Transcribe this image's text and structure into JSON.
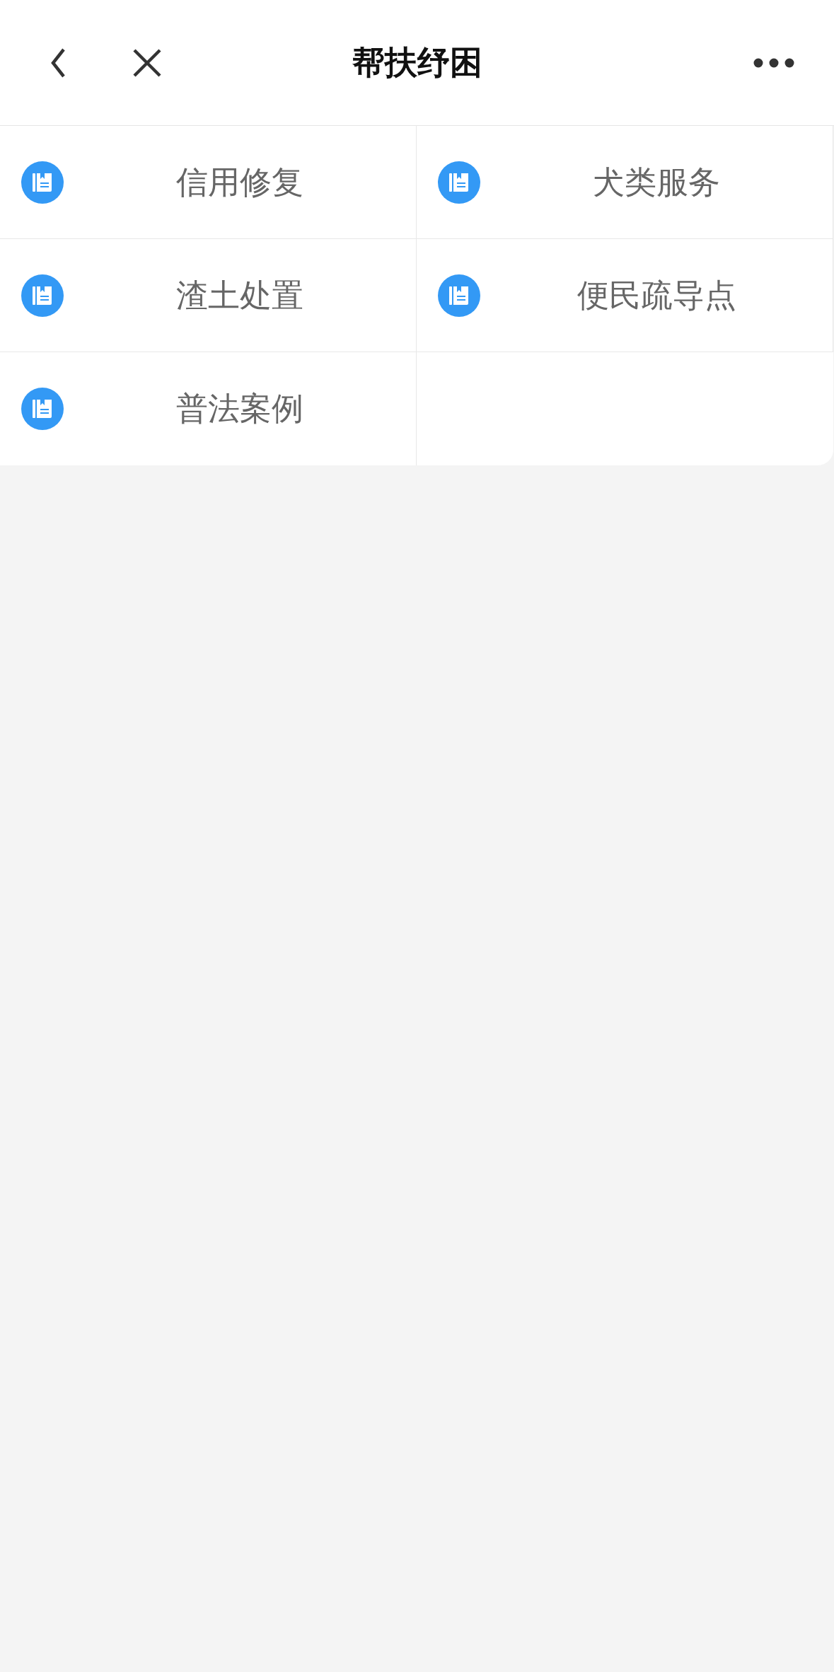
{
  "nav_bar": {
    "title": "帮扶纾困"
  },
  "menu": {
    "items": [
      {
        "label": "信用修复"
      },
      {
        "label": "犬类服务"
      },
      {
        "label": "渣土处置"
      },
      {
        "label": "便民疏导点"
      },
      {
        "label": "普法案例"
      }
    ]
  }
}
